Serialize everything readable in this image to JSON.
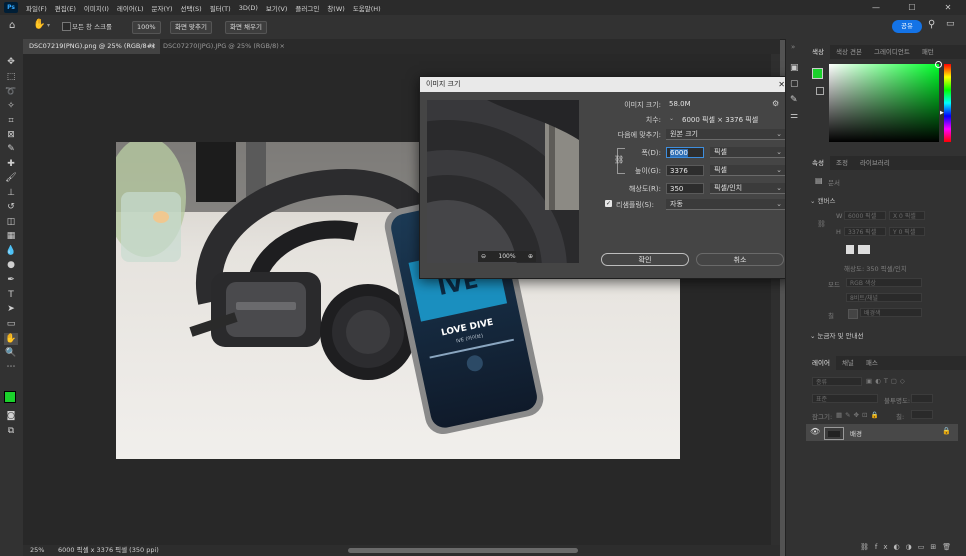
{
  "app": {
    "logo": "Ps"
  },
  "menu": [
    "파일(F)",
    "편집(E)",
    "이미지(I)",
    "레이어(L)",
    "문자(Y)",
    "선택(S)",
    "필터(T)",
    "3D(D)",
    "보기(V)",
    "플러그인",
    "창(W)",
    "도움말(H)"
  ],
  "window_controls": {
    "minimize": "—",
    "maximize": "☐",
    "close": "✕"
  },
  "options_bar": {
    "scroll_all": "모든 창 스크롤",
    "zoom": "100%",
    "fit_screen": "화면 맞추기",
    "fill_screen": "화면 채우기",
    "share": "공유"
  },
  "tabs": [
    {
      "label": "DSC07219(PNG).png @ 25% (RGB/8#)",
      "close": "×"
    },
    {
      "label": "DSC07270(JPG).JPG @ 25% (RGB/8)",
      "close": "×"
    }
  ],
  "photo": {
    "album_title": "LOVE DIVE",
    "album_artist": "IVE (아이브)",
    "cover_text": "IVE"
  },
  "status": {
    "zoom": "25%",
    "info": "6000 픽셀 x 3376 픽셀 (350 ppi)"
  },
  "dialog": {
    "title": "이미지 크기",
    "close": "✕",
    "preview_zoom": "100%",
    "image_size_label": "이미지 크기:",
    "image_size_value": "58.0M",
    "dimensions_label": "치수:",
    "dimensions_value": "6000 픽셀  ×  3376 픽셀",
    "fit_label": "다음에 맞추기:",
    "fit_value": "원본 크기",
    "width_label": "폭(D):",
    "width_value": "6000",
    "width_unit": "픽셀",
    "height_label": "높이(G):",
    "height_value": "3376",
    "height_unit": "픽셀",
    "resolution_label": "해상도(R):",
    "resolution_value": "350",
    "resolution_unit": "픽셀/인치",
    "resample_label": "리샘플링(S):",
    "resample_value": "자동",
    "ok": "확인",
    "cancel": "취소"
  },
  "right_panel": {
    "color_tabs": [
      "색상",
      "색상 견본",
      "그레이디언트",
      "패턴"
    ],
    "prop_tabs": [
      "속성",
      "조정",
      "라이브러리"
    ],
    "document_label": "문서",
    "canvas_header": "캔버스",
    "canvas_w": "6000 픽셀",
    "canvas_x": "X 0 픽셀",
    "canvas_h": "3376 픽셀",
    "canvas_y": "Y 0 픽셀",
    "resolution": "해상도: 350 픽셀/인치",
    "mode_label": "모드",
    "mode_value": "RGB 색상",
    "bit_value": "8비트/채널",
    "fill_label": "칠",
    "fill_value": "배경색",
    "rulers_header": "눈금자 및 안내선",
    "layer_tabs": [
      "레이어",
      "채널",
      "패스"
    ],
    "layer_kind": "종류",
    "blend_mode": "표준",
    "opacity": "불투명도:",
    "lock_label": "잠그기:",
    "fill_pct": "칠:",
    "layer_name": "배경"
  },
  "colors": {
    "foreground": "#1ad12b",
    "background": "#ffffff",
    "hue_top": "#00ff2a",
    "accent": "#1473e6"
  }
}
